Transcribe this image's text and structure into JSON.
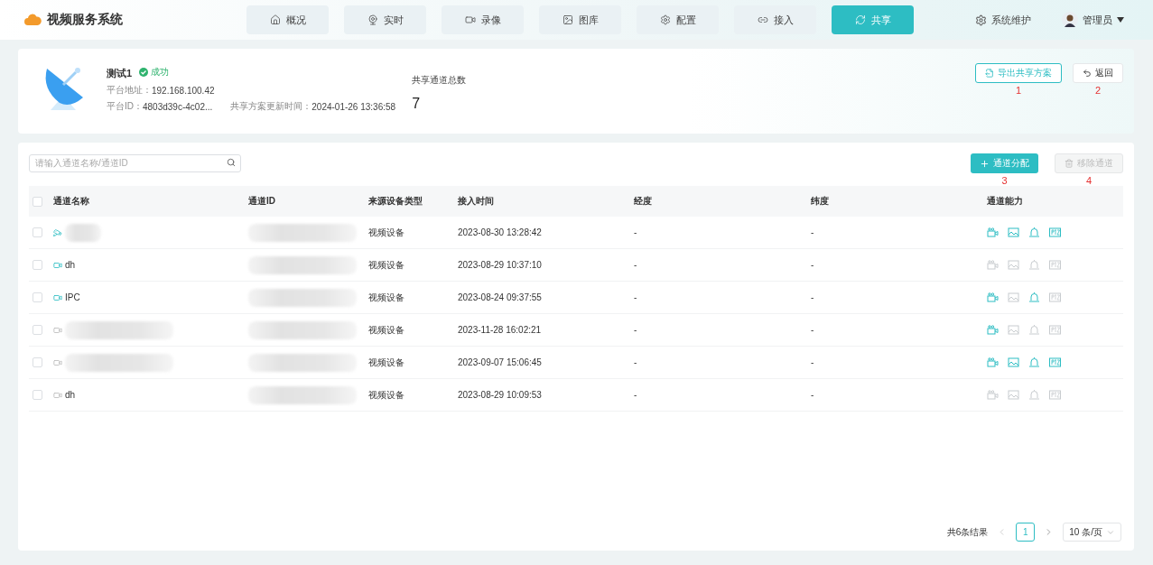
{
  "app": {
    "title": "视频服务系统"
  },
  "nav": [
    {
      "label": "概况",
      "selected": false
    },
    {
      "label": "实时",
      "selected": false
    },
    {
      "label": "录像",
      "selected": false
    },
    {
      "label": "图库",
      "selected": false
    },
    {
      "label": "配置",
      "selected": false
    },
    {
      "label": "接入",
      "selected": false
    },
    {
      "label": "共享",
      "selected": true
    }
  ],
  "maintenance": {
    "label": "系统维护"
  },
  "user": {
    "name": "管理员"
  },
  "platform": {
    "name": "测试1",
    "status": "成功",
    "address_label": "平台地址：",
    "address": "192.168.100.42",
    "id_label": "平台ID：",
    "id": "4803d39c-4c02...",
    "updated_label": "共享方案更新时间：",
    "updated": "2024-01-26 13:36:58",
    "total_label": "共享通道总数",
    "total": "7"
  },
  "header_buttons": [
    {
      "label": "导出共享方案",
      "kind": "outline",
      "annotation": "1"
    },
    {
      "label": "返回",
      "kind": "plain",
      "annotation": "2"
    }
  ],
  "search": {
    "placeholder": "请输入通道名称/通道ID"
  },
  "table_buttons": [
    {
      "label": "通道分配",
      "kind": "primary",
      "disabled": false,
      "annotation": "3"
    },
    {
      "label": "移除通道",
      "kind": "danger",
      "disabled": true,
      "annotation": "4"
    }
  ],
  "table": {
    "all_checked": false,
    "columns": [
      "通道名称",
      "通道ID",
      "来源设备类型",
      "接入时间",
      "经度",
      "纬度",
      "通道能力"
    ],
    "rows": [
      {
        "checked": false,
        "kind": "dome",
        "online": true,
        "name_hidden": true,
        "type": "视频设备",
        "time": "2023-08-30 13:28:42",
        "lng": "-",
        "lat": "-",
        "caps": {
          "video": true,
          "picture": true,
          "alarm": true,
          "ptz": true
        }
      },
      {
        "checked": false,
        "kind": "camera",
        "online": true,
        "name": "dh",
        "type": "视频设备",
        "time": "2023-08-29 10:37:10",
        "lng": "-",
        "lat": "-",
        "caps": {
          "video": false,
          "picture": false,
          "alarm": false,
          "ptz": false
        }
      },
      {
        "checked": false,
        "kind": "camera",
        "online": true,
        "name": "IPC",
        "type": "视频设备",
        "time": "2023-08-24 09:37:55",
        "lng": "-",
        "lat": "-",
        "caps": {
          "video": true,
          "picture": false,
          "alarm": true,
          "ptz": false
        }
      },
      {
        "checked": false,
        "kind": "camera",
        "online": false,
        "name_hidden": true,
        "type": "视频设备",
        "time": "2023-11-28 16:02:21",
        "lng": "-",
        "lat": "-",
        "caps": {
          "video": true,
          "picture": false,
          "alarm": false,
          "ptz": false
        }
      },
      {
        "checked": false,
        "kind": "camera",
        "online": false,
        "name_hidden": true,
        "type": "视频设备",
        "time": "2023-09-07 15:06:45",
        "lng": "-",
        "lat": "-",
        "caps": {
          "video": true,
          "picture": true,
          "alarm": true,
          "ptz": true
        }
      },
      {
        "checked": false,
        "kind": "camera",
        "online": false,
        "name": "dh",
        "type": "视频设备",
        "time": "2023-08-29 10:09:53",
        "lng": "-",
        "lat": "-",
        "caps": {
          "video": false,
          "picture": false,
          "alarm": false,
          "ptz": false
        }
      }
    ]
  },
  "pagination": {
    "total": "共6条结果",
    "pages": [
      {
        "label": "1",
        "selected": true
      }
    ],
    "page_size": "10 条/页"
  }
}
